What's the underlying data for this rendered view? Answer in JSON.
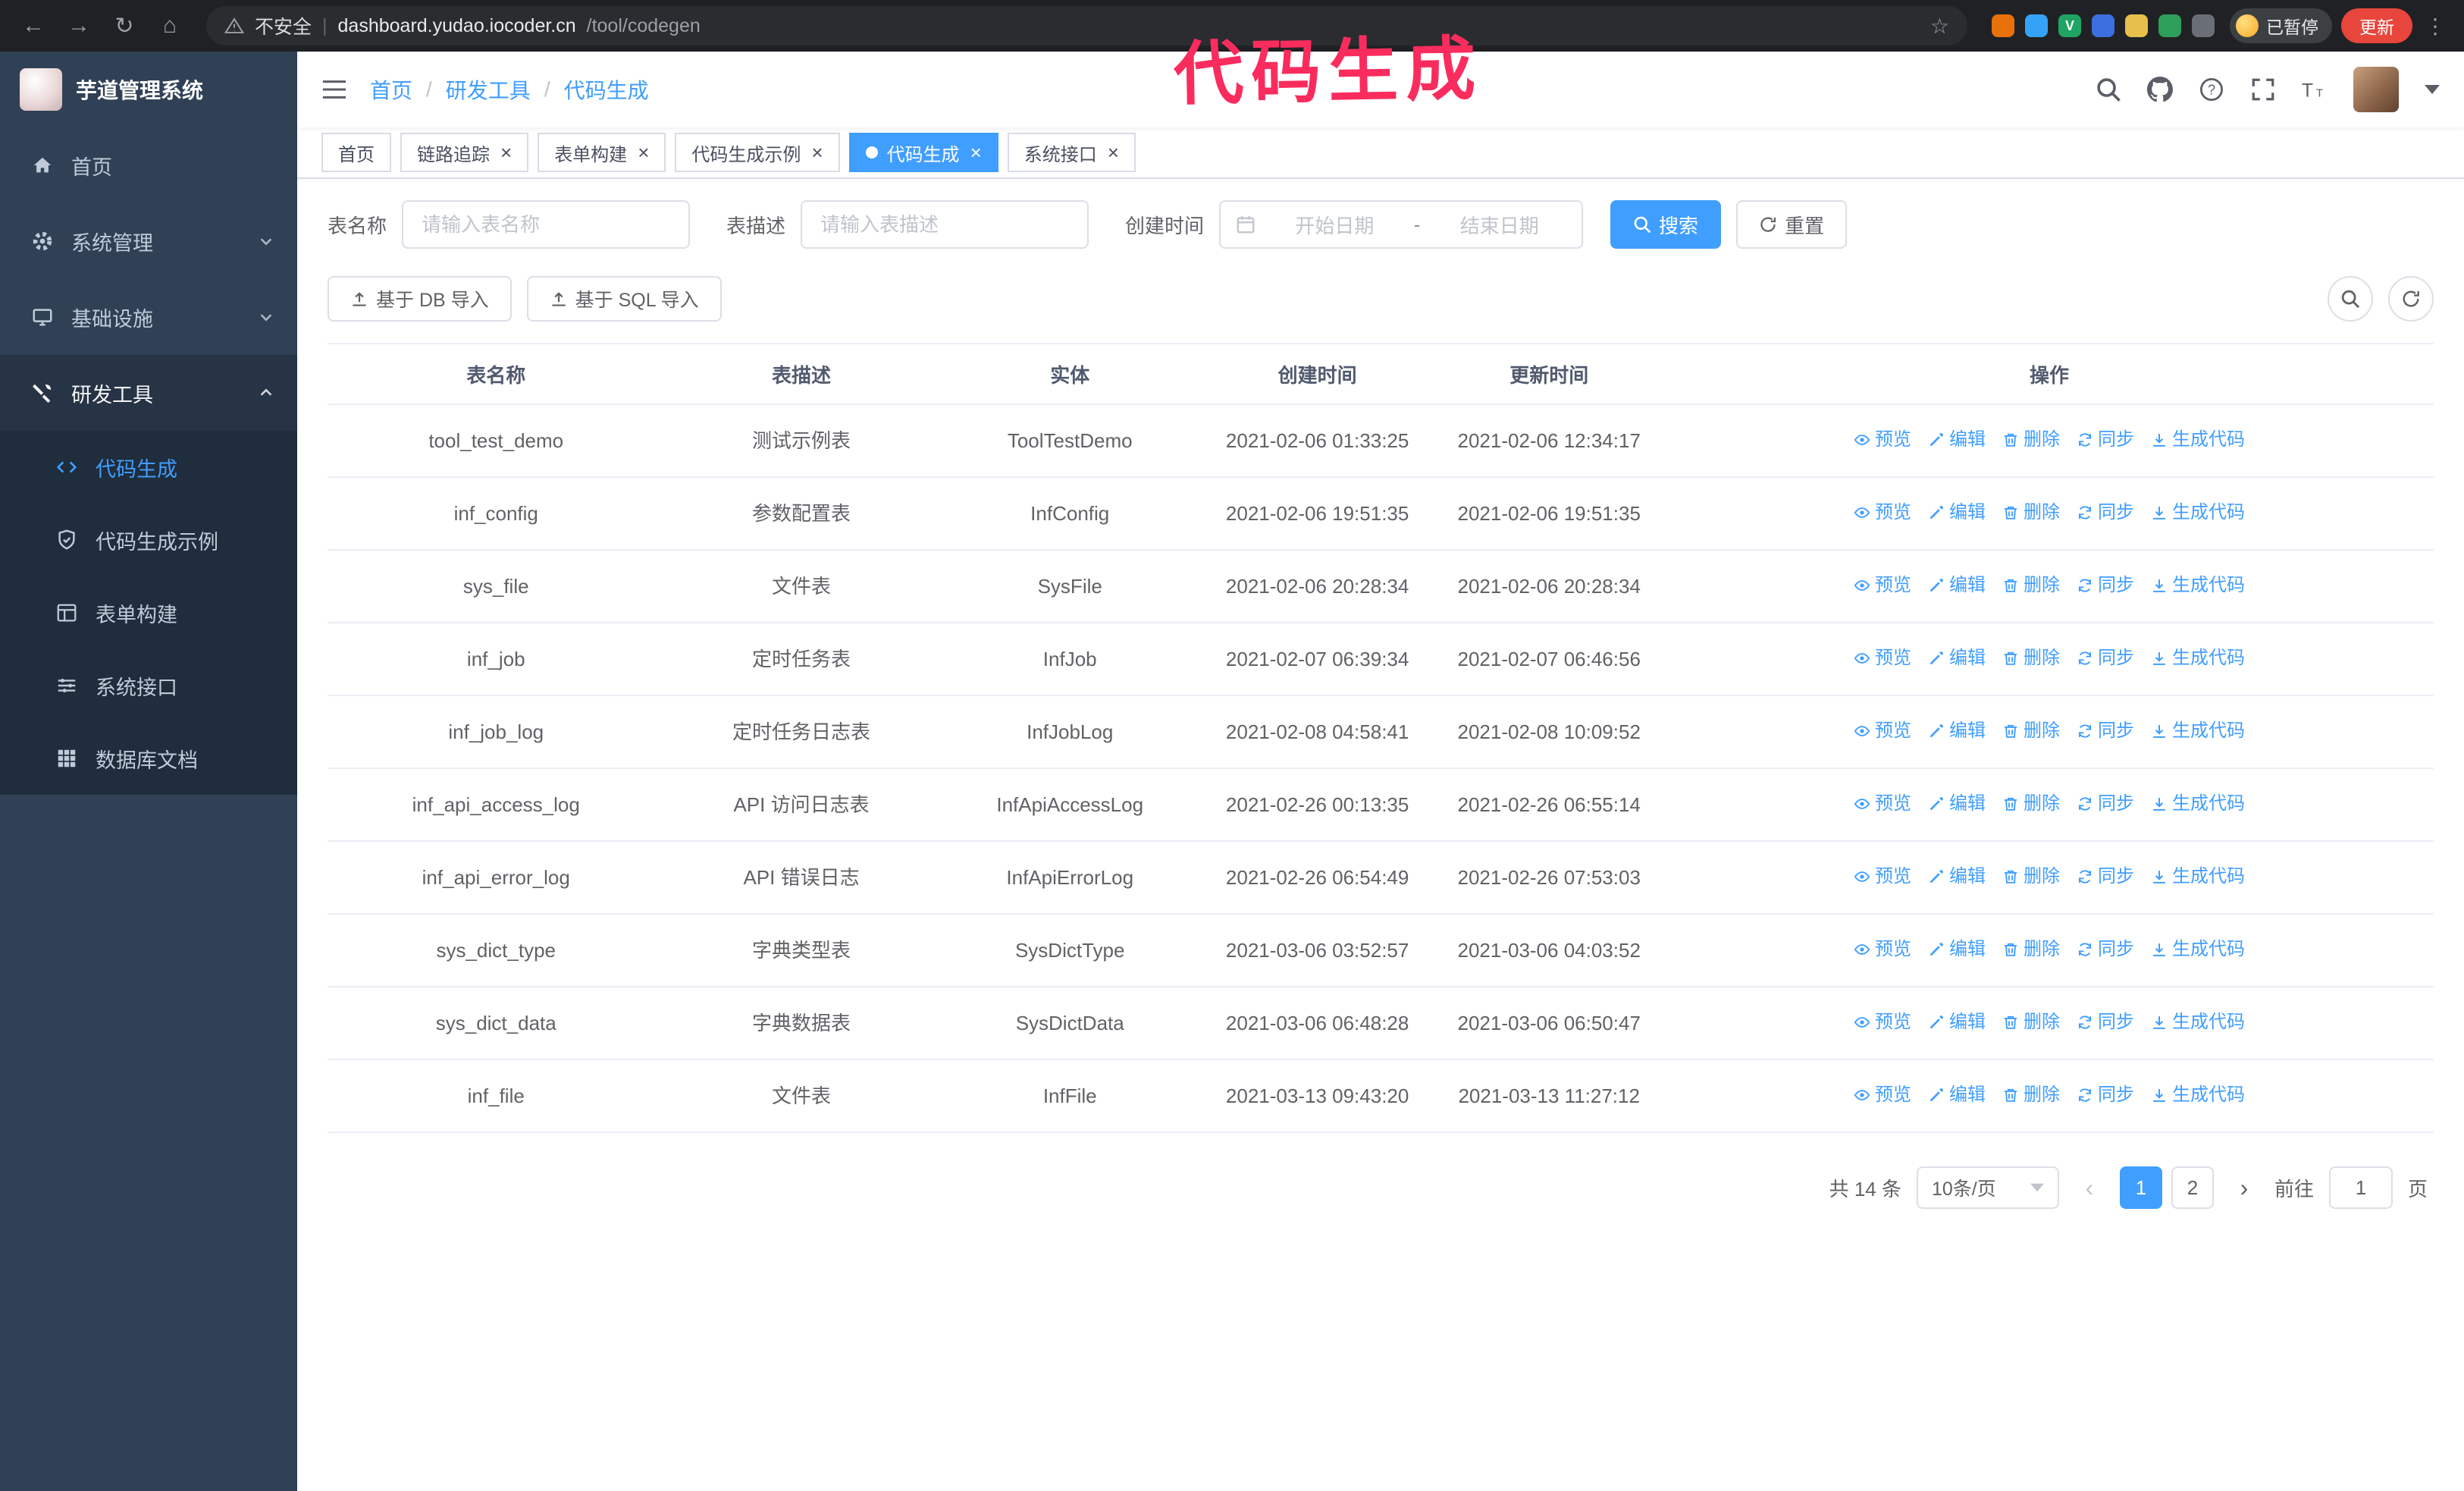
{
  "colors": {
    "primary": "#409eff",
    "sidebar_bg": "#304156",
    "submenu_bg": "#1f2d3d",
    "annotation": "#fa2c5e",
    "browser_bar": "#202124",
    "update_button": "#e8453c"
  },
  "annotation": {
    "text": "代码生成"
  },
  "browser": {
    "security_label": "不安全",
    "url_host": "dashboard.yudao.iocoder.cn",
    "url_path": "/tool/codegen",
    "paused_badge": "已暂停",
    "update_button": "更新",
    "extensions": [
      {
        "color": "#e8710a"
      },
      {
        "color": "#35a3f5"
      },
      {
        "color": "#1fa463",
        "glyph": "V"
      },
      {
        "color": "#3b6fe0"
      },
      {
        "color": "#e6c04a"
      },
      {
        "color": "#2e9e5b"
      },
      {
        "color": "#6a6f75"
      }
    ]
  },
  "sidebar": {
    "logo_title": "芋道管理系统",
    "items": [
      {
        "key": "home",
        "label": "首页",
        "icon": "home"
      },
      {
        "key": "system",
        "label": "系统管理",
        "icon": "gear",
        "chevron": "down"
      },
      {
        "key": "infra",
        "label": "基础设施",
        "icon": "infra",
        "chevron": "down"
      },
      {
        "key": "devtools",
        "label": "研发工具",
        "icon": "tools",
        "chevron": "up",
        "open": true,
        "children": [
          {
            "key": "codegen",
            "label": "代码生成",
            "icon": "code",
            "active": true
          },
          {
            "key": "codegen-example",
            "label": "代码生成示例",
            "icon": "example"
          },
          {
            "key": "form-builder",
            "label": "表单构建",
            "icon": "form"
          },
          {
            "key": "system-api",
            "label": "系统接口",
            "icon": "api"
          },
          {
            "key": "db-doc",
            "label": "数据库文档",
            "icon": "db"
          }
        ]
      }
    ]
  },
  "header": {
    "breadcrumb": [
      "首页",
      "研发工具",
      "代码生成"
    ]
  },
  "tabs": [
    {
      "label": "首页",
      "closable": false
    },
    {
      "label": "链路追踪",
      "closable": true
    },
    {
      "label": "表单构建",
      "closable": true
    },
    {
      "label": "代码生成示例",
      "closable": true
    },
    {
      "label": "代码生成",
      "closable": true,
      "active": true
    },
    {
      "label": "系统接口",
      "closable": true
    }
  ],
  "filters": {
    "table_name_label": "表名称",
    "table_name_placeholder": "请输入表名称",
    "table_desc_label": "表描述",
    "table_desc_placeholder": "请输入表描述",
    "create_time_label": "创建时间",
    "start_date_placeholder": "开始日期",
    "date_separator": "-",
    "end_date_placeholder": "结束日期",
    "search_button": "搜索",
    "reset_button": "重置"
  },
  "toolbar": {
    "import_db": "基于 DB 导入",
    "import_sql": "基于 SQL 导入"
  },
  "table": {
    "columns": [
      "表名称",
      "表描述",
      "实体",
      "创建时间",
      "更新时间",
      "操作"
    ],
    "actions": [
      {
        "key": "preview",
        "label": "预览",
        "icon": "eye"
      },
      {
        "key": "edit",
        "label": "编辑",
        "icon": "edit"
      },
      {
        "key": "delete",
        "label": "删除",
        "icon": "trash"
      },
      {
        "key": "sync",
        "label": "同步",
        "icon": "sync"
      },
      {
        "key": "generate",
        "label": "生成代码",
        "icon": "download"
      }
    ],
    "rows": [
      {
        "name": "tool_test_demo",
        "desc": "测试示例表",
        "entity": "ToolTestDemo",
        "created": "2021-02-06 01:33:25",
        "updated": "2021-02-06 12:34:17"
      },
      {
        "name": "inf_config",
        "desc": "参数配置表",
        "entity": "InfConfig",
        "created": "2021-02-06 19:51:35",
        "updated": "2021-02-06 19:51:35"
      },
      {
        "name": "sys_file",
        "desc": "文件表",
        "entity": "SysFile",
        "created": "2021-02-06 20:28:34",
        "updated": "2021-02-06 20:28:34"
      },
      {
        "name": "inf_job",
        "desc": "定时任务表",
        "entity": "InfJob",
        "created": "2021-02-07 06:39:34",
        "updated": "2021-02-07 06:46:56"
      },
      {
        "name": "inf_job_log",
        "desc": "定时任务日志表",
        "entity": "InfJobLog",
        "created": "2021-02-08 04:58:41",
        "updated": "2021-02-08 10:09:52"
      },
      {
        "name": "inf_api_access_log",
        "desc": "API 访问日志表",
        "entity": "InfApiAccessLog",
        "created": "2021-02-26 00:13:35",
        "updated": "2021-02-26 06:55:14"
      },
      {
        "name": "inf_api_error_log",
        "desc": "API 错误日志",
        "entity": "InfApiErrorLog",
        "created": "2021-02-26 06:54:49",
        "updated": "2021-02-26 07:53:03"
      },
      {
        "name": "sys_dict_type",
        "desc": "字典类型表",
        "entity": "SysDictType",
        "created": "2021-03-06 03:52:57",
        "updated": "2021-03-06 04:03:52"
      },
      {
        "name": "sys_dict_data",
        "desc": "字典数据表",
        "entity": "SysDictData",
        "created": "2021-03-06 06:48:28",
        "updated": "2021-03-06 06:50:47"
      },
      {
        "name": "inf_file",
        "desc": "文件表",
        "entity": "InfFile",
        "created": "2021-03-13 09:43:20",
        "updated": "2021-03-13 11:27:12"
      }
    ]
  },
  "pagination": {
    "total": "共 14 条",
    "page_size": "10条/页",
    "pages": [
      {
        "label": "1",
        "active": true
      },
      {
        "label": "2"
      }
    ],
    "goto_label": "前往",
    "goto_value": "1",
    "page_unit": "页"
  },
  "icons": [
    "back-icon",
    "forward-icon",
    "reload-icon",
    "home-icon",
    "warning-icon",
    "bookmark-star-icon",
    "extension-icon",
    "menu-kebab-icon",
    "hamburger-icon",
    "search-icon",
    "github-icon",
    "help-icon",
    "fullscreen-icon",
    "font-size-icon",
    "caret-down-icon",
    "calendar-icon",
    "refresh-icon",
    "upload-icon",
    "eye-icon",
    "edit-icon",
    "trash-icon",
    "sync-icon",
    "download-icon",
    "close-icon",
    "chevron-down-icon",
    "chevron-up-icon"
  ]
}
